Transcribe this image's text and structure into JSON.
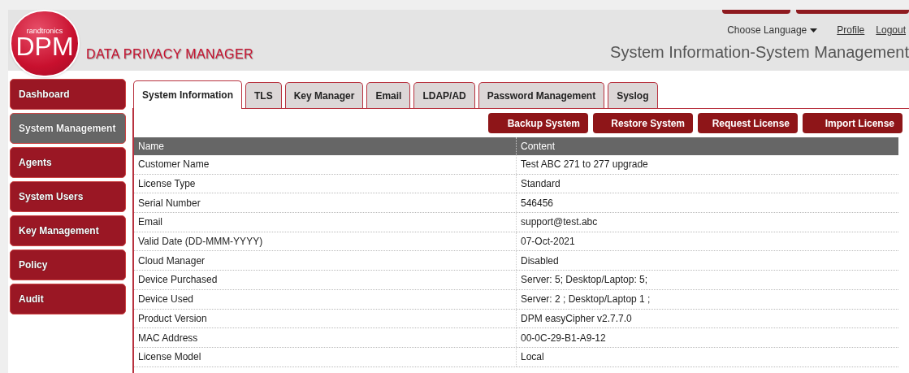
{
  "header": {
    "logo": {
      "brand": "randtronics",
      "mark": "DPM"
    },
    "product_name": "DATA PRIVACY MANAGER",
    "language_menu": "Choose Language",
    "links": [
      "Profile",
      "Logout"
    ],
    "page_title": "System Information-System Management"
  },
  "sidebar": {
    "items": [
      {
        "label": "Dashboard",
        "selected": false
      },
      {
        "label": "System Management",
        "selected": true
      },
      {
        "label": "Agents",
        "selected": false
      },
      {
        "label": "System Users",
        "selected": false
      },
      {
        "label": "Key Management",
        "selected": false
      },
      {
        "label": "Policy",
        "selected": false
      },
      {
        "label": "Audit",
        "selected": false
      }
    ]
  },
  "tabs": [
    {
      "label": "System Information",
      "selected": true
    },
    {
      "label": "TLS",
      "selected": false
    },
    {
      "label": "Key Manager",
      "selected": false
    },
    {
      "label": "Email",
      "selected": false
    },
    {
      "label": "LDAP/AD",
      "selected": false
    },
    {
      "label": "Password Management",
      "selected": false
    },
    {
      "label": "Syslog",
      "selected": false
    }
  ],
  "actions": [
    "Backup System",
    "Restore System",
    "Request License",
    "Import License"
  ],
  "table": {
    "columns": [
      "Name",
      "Content"
    ],
    "rows": [
      [
        "Customer Name",
        "Test ABC 271 to 277 upgrade"
      ],
      [
        "License Type",
        "Standard"
      ],
      [
        "Serial Number",
        "546456"
      ],
      [
        "Email",
        "support@test.abc"
      ],
      [
        "Valid Date (DD-MMM-YYYY)",
        "07-Oct-2021"
      ],
      [
        "Cloud Manager",
        "Disabled"
      ],
      [
        "Device Purchased",
        "Server: 5; Desktop/Laptop: 5;"
      ],
      [
        "Device Used",
        "Server: 2 ; Desktop/Laptop 1 ;"
      ],
      [
        "Product Version",
        "DPM easyCipher v2.7.7.0"
      ],
      [
        "MAC Address",
        "00-0C-29-B1-A9-12"
      ],
      [
        "License Model",
        "Local"
      ]
    ]
  }
}
